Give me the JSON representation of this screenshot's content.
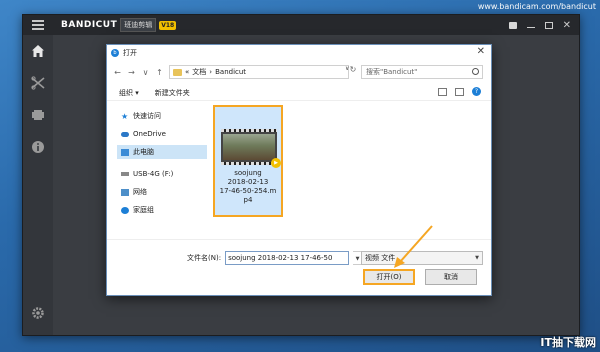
{
  "watermark_top": "www.bandicam.com/bandicut",
  "watermark_bottom": "IT抽下载网",
  "app": {
    "brand": "BANDICUT",
    "brand_sub": "班迪剪辑",
    "version_badge": "V18"
  },
  "dialog": {
    "title": "打开",
    "address": {
      "sep1": "«",
      "crumb1": "文档",
      "sep2": "›",
      "crumb2": "Bandicut",
      "dropdown": "∨",
      "refresh": "↻"
    },
    "search_placeholder": "搜索\"Bandicut\"",
    "organize_label": "组织 ▾",
    "new_folder_label": "新建文件夹",
    "nav_items": [
      {
        "label": "快速访问",
        "icon": "star-icon"
      },
      {
        "label": "OneDrive",
        "icon": "cloud-icon"
      },
      {
        "label": "此电脑",
        "icon": "computer-icon"
      },
      {
        "label": "USB-4G (F:)",
        "icon": "usb-drive-icon"
      },
      {
        "label": "网络",
        "icon": "network-icon"
      },
      {
        "label": "家庭组",
        "icon": "homegroup-icon"
      }
    ],
    "file": {
      "name": "soojung 2018-02-13 17-46-50-254.mp4",
      "name_display_lines": [
        "soojung",
        "2018-02-13",
        "17-46-50-254.m",
        "p4"
      ]
    },
    "filename_label": "文件名(N):",
    "filename_value": "soojung 2018-02-13 17-46-50",
    "filetype_value": "视频 文件",
    "open_button": "打开(O)",
    "cancel_button": "取消"
  },
  "colors": {
    "highlight": "#f5a623",
    "accent": "#1d7fd6",
    "wallpaper": "#2a6aab"
  }
}
